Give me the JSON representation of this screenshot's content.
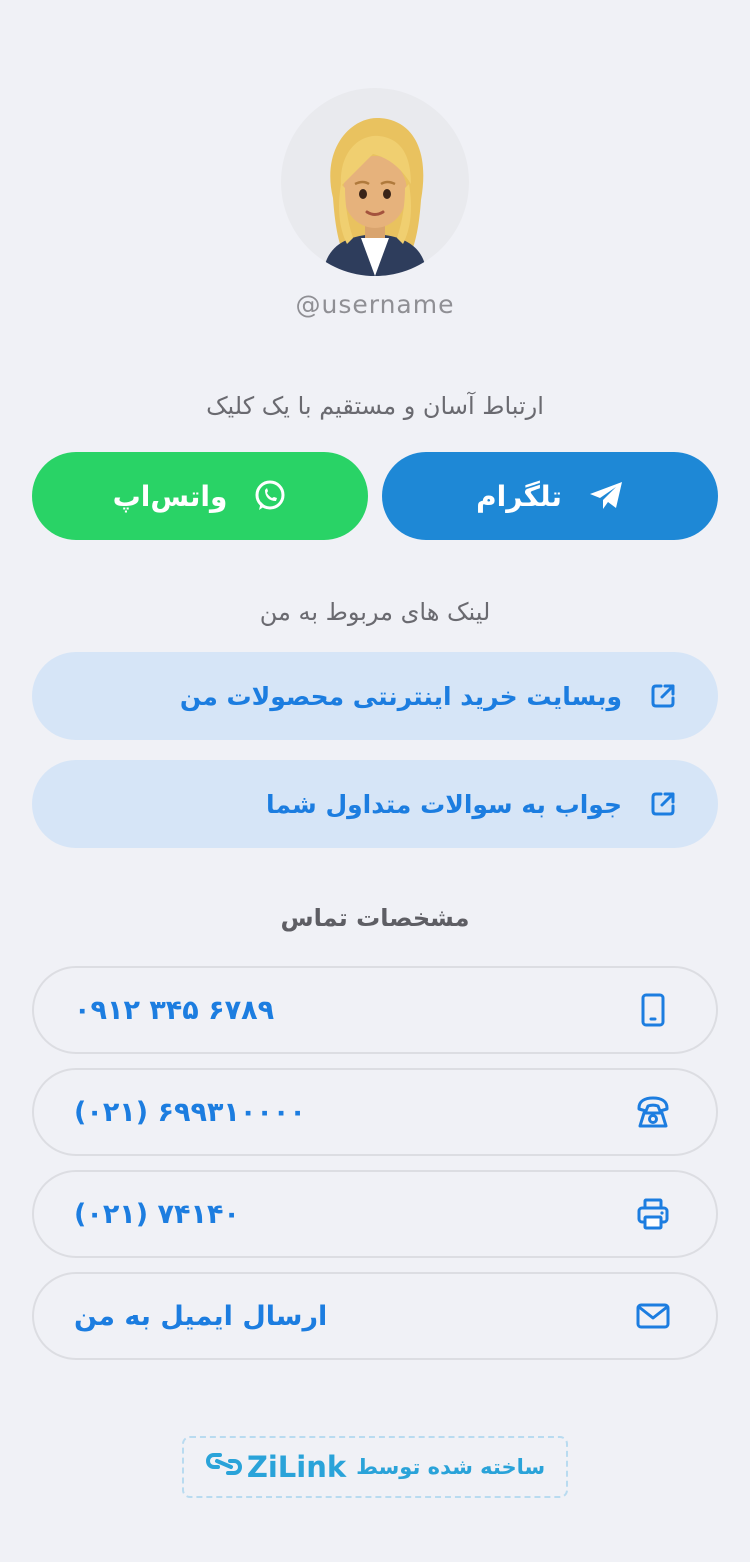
{
  "profile": {
    "username": "@username"
  },
  "sections": {
    "contact_title": "ارتباط آسان و مستقیم با یک کلیک",
    "links_title": "لینک های مربوط به من",
    "details_title": "مشخصات تماس"
  },
  "buttons": {
    "telegram_label": "تلگرام",
    "whatsapp_label": "واتس‌اپ"
  },
  "links": [
    {
      "label": "وبسایت خرید اینترنتی محصولات من",
      "icon": "external-link-icon"
    },
    {
      "label": "جواب به سوالات متداول شما",
      "icon": "external-link-icon"
    }
  ],
  "contacts": [
    {
      "value": "۰۹۱۲ ۳۴۵ ۶۷۸۹",
      "icon": "mobile-phone-icon"
    },
    {
      "value": "(۰۲۱) ۶۹۹۳۱۰۰۰۰",
      "icon": "telephone-icon"
    },
    {
      "value": "(۰۲۱) ۷۴۱۴۰",
      "icon": "fax-icon"
    },
    {
      "value": "ارسال ایمیل به من",
      "icon": "email-icon"
    }
  ],
  "footer": {
    "made_by": "ساخته شده توسط",
    "brand": "ZiLink"
  },
  "colors": {
    "background": "#f0f1f6",
    "telegram": "#1e88d6",
    "whatsapp": "#29d366",
    "accent": "#1c7de0",
    "link_bg": "#d6e5f7",
    "footer_accent": "#2aa3d9"
  }
}
